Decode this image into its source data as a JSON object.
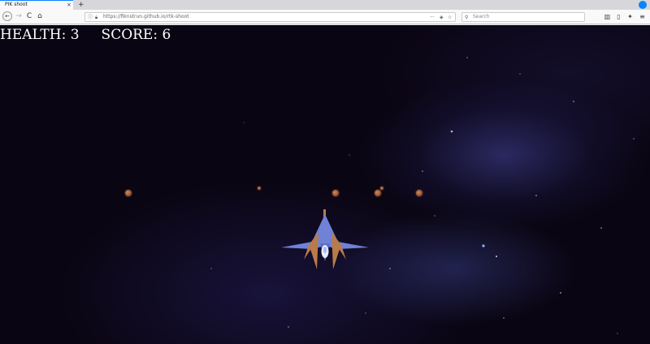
{
  "browser": {
    "tab": {
      "title": "PIK shoot",
      "close_glyph": "×",
      "new_tab_glyph": "+"
    },
    "nav": {
      "back_glyph": "←",
      "forward_glyph": "→",
      "reload_glyph": "C",
      "home_glyph": "⌂"
    },
    "url": {
      "value": "https://fiknstrun.github.io/rtk-shoot"
    },
    "search": {
      "placeholder": "Search"
    },
    "icons": [
      "menu-icon",
      "bookmarks-icon",
      "reader-icon",
      "star-icon",
      "library-icon",
      "sidebar-icon",
      "extensions-icon",
      "account-icon"
    ]
  },
  "hud": {
    "health_label": "HEALTH:",
    "health_value": "3",
    "score_label": "SCORE:",
    "score_value": "6"
  },
  "game": {
    "player": {
      "name": "player-ship",
      "colors": {
        "wing": "#6f82d6",
        "body": "#b97b4a",
        "cockpit": "#dfe6ff"
      }
    },
    "enemy_count": 6,
    "enemy_color": "#b5683f",
    "background_color": "#0a0512"
  }
}
